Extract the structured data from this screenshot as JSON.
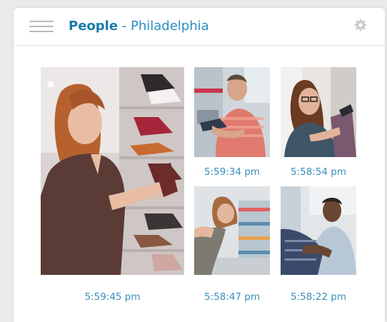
{
  "header": {
    "title_strong": "People",
    "title_separator": " - ",
    "title_location": "Philadelphia",
    "menu_icon": "hamburger-menu-icon",
    "settings_icon": "gear-icon"
  },
  "colors": {
    "accent": "#1c7fb0",
    "timestamp": "#3b8fbd",
    "icon_gray": "#b4babd"
  },
  "photos": [
    {
      "id": "large",
      "time": "5:59:45 pm"
    },
    {
      "id": "top-middle",
      "time": "5:59:34 pm"
    },
    {
      "id": "top-right",
      "time": "5:58:54 pm"
    },
    {
      "id": "bottom-middle",
      "time": "5:58:47 pm"
    },
    {
      "id": "bottom-right",
      "time": "5:58:22 pm"
    }
  ]
}
